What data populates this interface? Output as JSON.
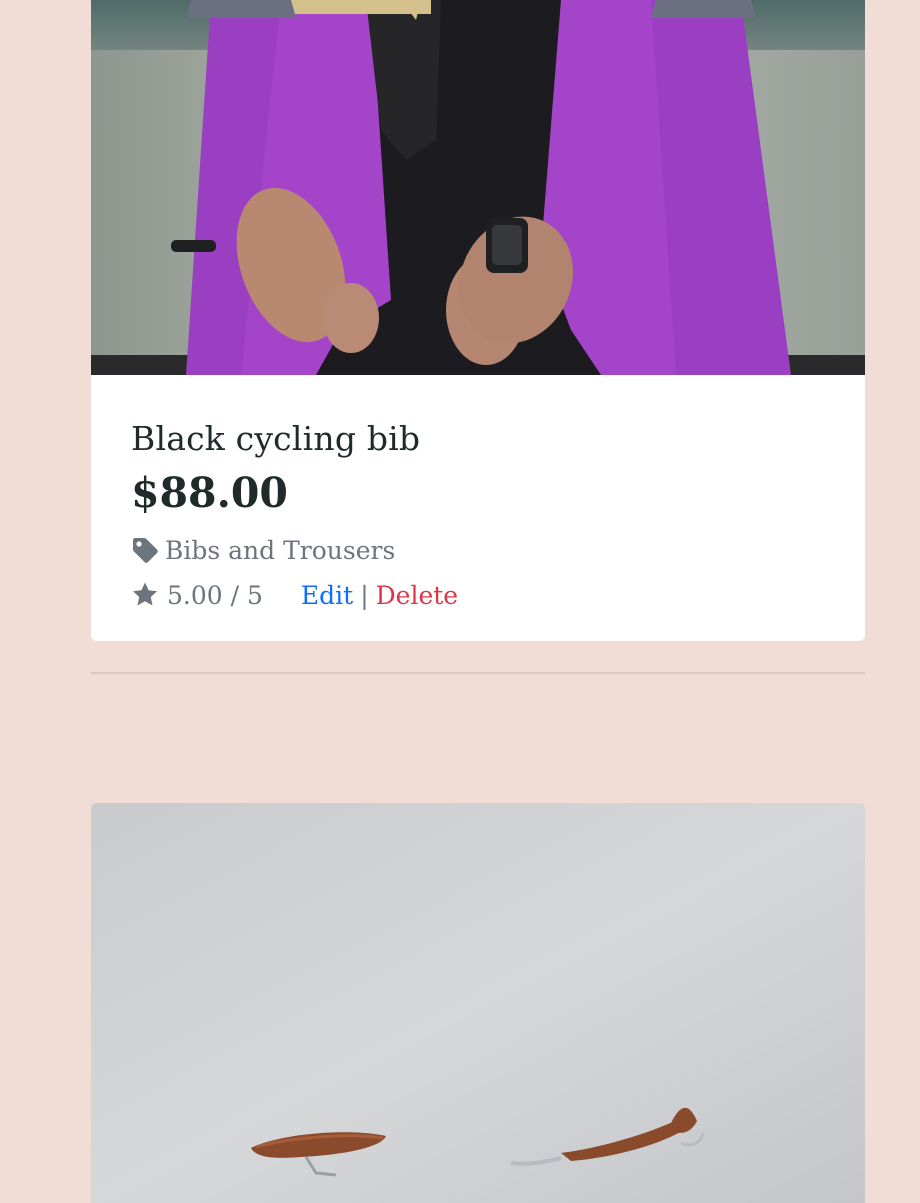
{
  "products": [
    {
      "title": "Black cycling bib",
      "price": "$88.00",
      "category": "Bibs and Trousers",
      "rating": "5.00 / 5",
      "edit_label": "Edit",
      "separator": "|",
      "delete_label": "Delete",
      "image_icon": "cyclist-jersey-photo"
    },
    {
      "image_icon": "bicycle-on-wall-photo"
    }
  ],
  "colors": {
    "page_bg": "#f1ddd5",
    "card_bg": "#ffffff",
    "heading": "#1f2a2a",
    "muted": "#6c757d",
    "edit": "#0d6efd",
    "delete": "#dc3545"
  },
  "icons": {
    "category": "tag-icon",
    "rating": "star-icon"
  }
}
